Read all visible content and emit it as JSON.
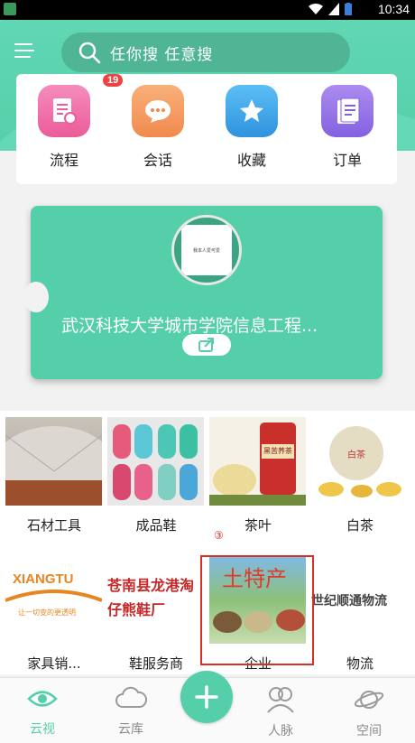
{
  "status_bar": {
    "time": "10:34"
  },
  "search": {
    "placeholder": "任你搜 任意搜"
  },
  "quick_actions": [
    {
      "label": "流程",
      "icon": "document-icon",
      "color": "#f374a9",
      "badge": "19"
    },
    {
      "label": "会话",
      "icon": "chat-icon",
      "color": "#f59a62"
    },
    {
      "label": "收藏",
      "icon": "star-icon",
      "color": "#42a8ea"
    },
    {
      "label": "订单",
      "icon": "clipboard-icon",
      "color": "#9570e6"
    }
  ],
  "banner": {
    "title": "武汉科技大学城市学院信息工程...",
    "avatar_text": "我本人爱可爱"
  },
  "products": [
    {
      "caption": "石材工具"
    },
    {
      "caption": "成品鞋"
    },
    {
      "caption": "茶叶",
      "image_text": "黑苦荞茶"
    },
    {
      "caption": "白茶"
    },
    {
      "caption": "家具销...",
      "image_text": "XIANGTU",
      "image_subtext": "让一切变的更透明"
    },
    {
      "caption": "鞋服务商",
      "image_text": "苍南县龙港淘仔熊鞋厂"
    },
    {
      "caption": "企业",
      "image_text": "土特产"
    },
    {
      "caption": "物流",
      "image_text": "世纪顺通物流"
    }
  ],
  "highlight_marker": "③",
  "bottom_nav": [
    {
      "label": "云视",
      "icon": "eye-icon",
      "active": true
    },
    {
      "label": "云库",
      "icon": "cloud-icon"
    },
    {
      "label": "人脉",
      "icon": "people-icon"
    },
    {
      "label": "空间",
      "icon": "planet-icon"
    }
  ],
  "colors": {
    "accent": "#55cfa9",
    "badge": "#f04141",
    "highlight": "#d93025"
  }
}
